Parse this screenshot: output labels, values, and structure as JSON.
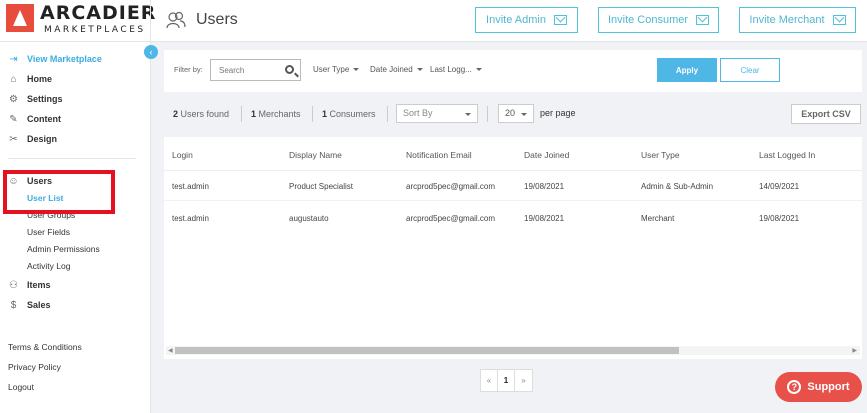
{
  "brand": {
    "name": "ARCADIER",
    "sub": "MARKETPLACES"
  },
  "header": {
    "title": "Users",
    "buttons": {
      "invite_admin": "Invite Admin",
      "invite_consumer": "Invite Consumer",
      "invite_merchant": "Invite Merchant"
    }
  },
  "sidebar": {
    "collapse_glyph": "‹",
    "view_marketplace": "View Marketplace",
    "home": "Home",
    "settings": "Settings",
    "content": "Content",
    "design": "Design",
    "users": "Users",
    "user_list": "User List",
    "user_groups": "User Groups",
    "user_fields": "User Fields",
    "admin_permissions": "Admin Permissions",
    "activity_log": "Activity Log",
    "items": "Items",
    "sales": "Sales",
    "terms": "Terms & Conditions",
    "privacy": "Privacy Policy",
    "logout": "Logout"
  },
  "filters": {
    "label": "Filter by:",
    "search_placeholder": "Search",
    "user_type": "User Type",
    "date_joined": "Date Joined",
    "last_logged": "Last Logg...",
    "apply": "Apply",
    "clear": "Clear"
  },
  "results": {
    "users_count": "2",
    "users_label": "Users found",
    "merchants_count": "1",
    "merchants_label": "Merchants",
    "consumers_count": "1",
    "consumers_label": "Consumers",
    "sort_by": "Sort By",
    "page_size": "20",
    "per_page": "per page",
    "export": "Export CSV"
  },
  "table": {
    "columns": [
      "Login",
      "Display Name",
      "Notification Email",
      "Date Joined",
      "User Type",
      "Last Logged In"
    ],
    "rows": [
      [
        "test.admin",
        "Product Specialist",
        "arcprod5pec@gmail.com",
        "19/08/2021",
        "Admin & Sub-Admin",
        "14/09/2021"
      ],
      [
        "test.admin",
        "augustauto",
        "arcprod5pec@gmail.com",
        "19/08/2021",
        "Merchant",
        "19/08/2021"
      ]
    ]
  },
  "pagination": {
    "prev": "«",
    "current": "1",
    "next": "»"
  },
  "support": {
    "label": "Support",
    "glyph": "?"
  },
  "colors": {
    "accent": "#4fb7e6",
    "highlight_box": "#e4121e",
    "support": "#e8504a",
    "brand_red": "#e74c3c"
  }
}
